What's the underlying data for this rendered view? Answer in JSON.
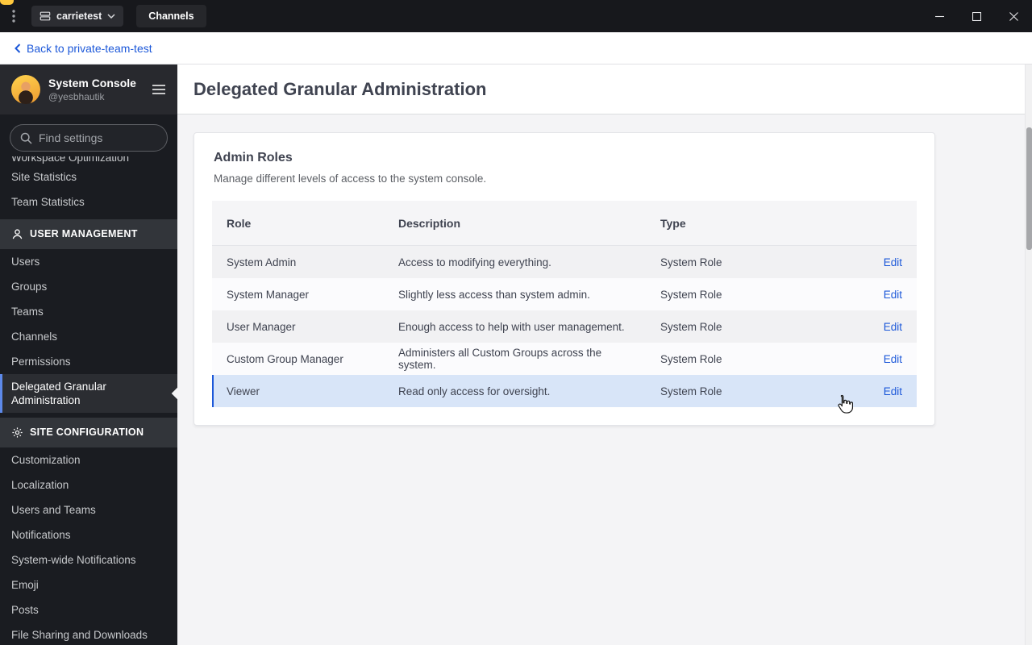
{
  "colors": {
    "accent_blue": "#1c58d9",
    "row_highlight": "#d8e5f8",
    "active_indicator": "#5d89ea"
  },
  "icons": [
    "vertical-dots-icon",
    "server-icon",
    "chevron-down-icon",
    "minimize-icon",
    "maximize-icon",
    "close-icon",
    "back-chevron-icon",
    "menu-icon",
    "search-icon",
    "users-icon",
    "gear-icon",
    "hand-cursor-icon"
  ],
  "titlebar": {
    "server_label": "carrietest",
    "tab_label": "Channels"
  },
  "backbar": {
    "label": "Back to private-team-test"
  },
  "sidebar": {
    "title": "System Console",
    "subtitle": "@yesbhautik",
    "search_placeholder": "Find settings",
    "clipped_item": "Workspace Optimization",
    "active_item": "Delegated Granular Administration",
    "sections": [
      {
        "items": [
          "Workspace Optimization",
          "Site Statistics",
          "Team Statistics"
        ]
      },
      {
        "header": "USER MANAGEMENT",
        "icon": "users-icon",
        "items": [
          "Users",
          "Groups",
          "Teams",
          "Channels",
          "Permissions",
          "Delegated Granular Administration"
        ]
      },
      {
        "header": "SITE CONFIGURATION",
        "icon": "gear-icon",
        "items": [
          "Customization",
          "Localization",
          "Users and Teams",
          "Notifications",
          "System-wide Notifications",
          "Emoji",
          "Posts",
          "File Sharing and Downloads"
        ]
      }
    ]
  },
  "main": {
    "page_title": "Delegated Granular Administration",
    "card": {
      "title": "Admin Roles",
      "subtitle": "Manage different levels of access to the system console.",
      "table": {
        "headers": [
          "Role",
          "Description",
          "Type"
        ],
        "rows": [
          {
            "role": "System Admin",
            "description": "Access to modifying everything.",
            "type": "System Role",
            "action": "Edit",
            "highlighted": false
          },
          {
            "role": "System Manager",
            "description": "Slightly less access than system admin.",
            "type": "System Role",
            "action": "Edit",
            "highlighted": false
          },
          {
            "role": "User Manager",
            "description": "Enough access to help with user management.",
            "type": "System Role",
            "action": "Edit",
            "highlighted": false
          },
          {
            "role": "Custom Group Manager",
            "description": "Administers all Custom Groups across the system.",
            "type": "System Role",
            "action": "Edit",
            "highlighted": false
          },
          {
            "role": "Viewer",
            "description": "Read only access for oversight.",
            "type": "System Role",
            "action": "Edit",
            "highlighted": true
          }
        ]
      }
    }
  }
}
